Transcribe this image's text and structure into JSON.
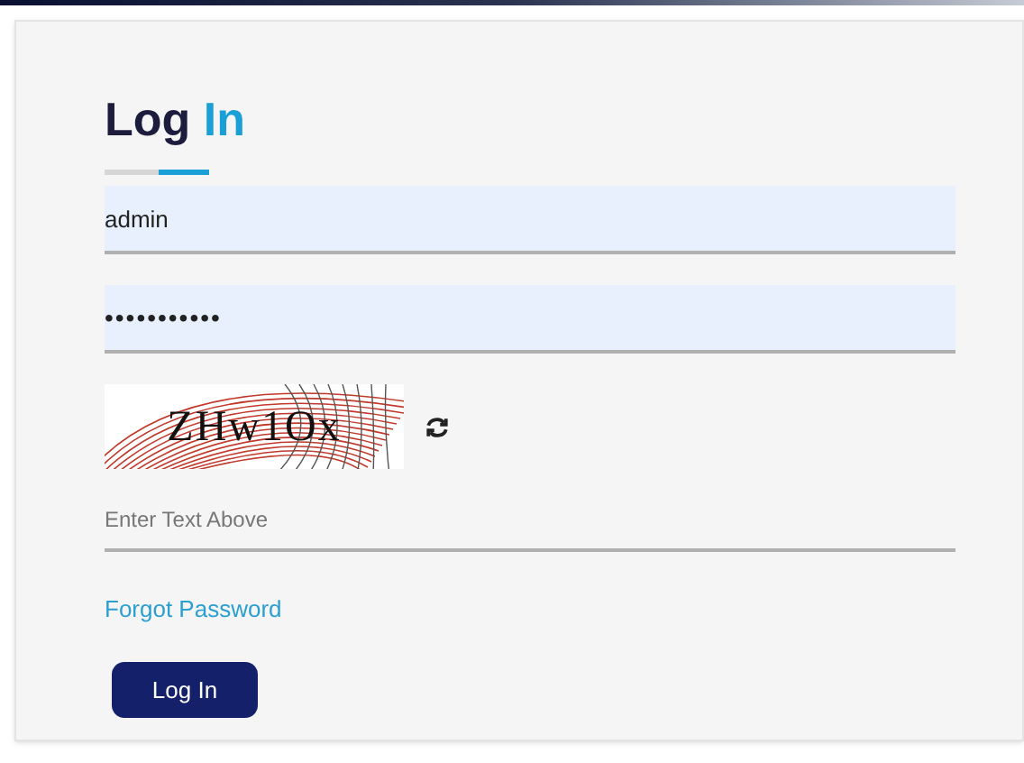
{
  "title": {
    "first": "Log",
    "second": "In"
  },
  "username": {
    "value": "admin"
  },
  "password": {
    "value": "•••••••••••"
  },
  "captcha": {
    "text": "ZHw1Ox"
  },
  "captcha_field": {
    "placeholder": "Enter Text Above"
  },
  "forgot_link": "Forgot Password",
  "submit": "Log In"
}
